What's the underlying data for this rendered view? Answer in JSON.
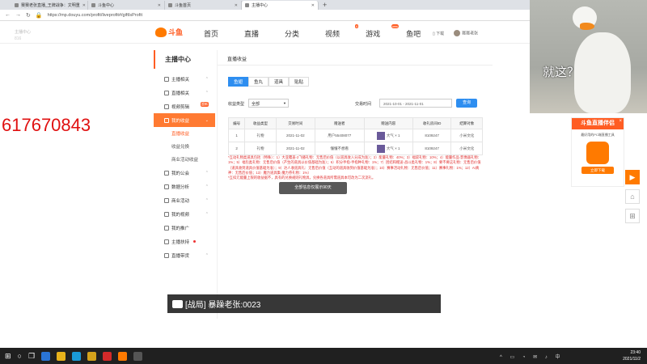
{
  "browser": {
    "tabs": [
      {
        "label": "赛赛老张直播_王牌战争：文明重",
        "active": false
      },
      {
        "label": "斗鱼中心",
        "active": false
      },
      {
        "label": "斗鱼首页",
        "active": false
      },
      {
        "label": "主播中心",
        "active": true
      }
    ],
    "url": "https://mp.douyu.com/profit/liveprofit#/giftIsProfit"
  },
  "ghost": {
    "line1": "主播中心",
    "line2": "816"
  },
  "overlay_number": "617670843",
  "header": {
    "logo": "斗鱼",
    "nav": [
      {
        "label": "首页",
        "badge": ""
      },
      {
        "label": "直播",
        "badge": ""
      },
      {
        "label": "分类",
        "badge": ""
      },
      {
        "label": "视频",
        "badge": "6"
      },
      {
        "label": "游戏",
        "badge": "new"
      },
      {
        "label": "鱼吧",
        "badge": ""
      }
    ],
    "download": "下载",
    "username": "赛赛老张"
  },
  "sidebar": {
    "title": "主播中心",
    "items": [
      {
        "label": "主播相关"
      },
      {
        "label": "直播相关"
      },
      {
        "label": "视频剪辑",
        "hot": "超新"
      },
      {
        "label": "我的收益",
        "active": true
      },
      {
        "label": "我的公会"
      },
      {
        "label": "数据分析"
      },
      {
        "label": "商业活动"
      },
      {
        "label": "我的视频"
      },
      {
        "label": "我的推广"
      },
      {
        "label": "主播扶持"
      },
      {
        "label": "直播带货"
      }
    ],
    "subitems": [
      "直播收益",
      "收益兑换",
      "商业活动收益"
    ]
  },
  "main": {
    "title": "直播收益",
    "subtabs": [
      "鱼翅",
      "鱼丸",
      "道具",
      "贴贴"
    ],
    "filter": {
      "type_label": "收益类型",
      "type_value": "全部",
      "time_label": "交易时间",
      "date_range": "2021-10-01 - 2021-11-01",
      "query_button": "查询"
    },
    "table": {
      "headers": [
        "编号",
        "收益类型",
        "交易时间",
        "赠送者",
        "赠送内容",
        "收礼房间ID",
        "结算对象"
      ],
      "rows": [
        [
          "1",
          "礼物",
          "2021-11-02",
          "用户55408077",
          "大气 × 1",
          "8109247",
          "小米文化"
        ],
        [
          "2",
          "礼物",
          "2021-11-02",
          "懂懂不想看",
          "大气 × 1",
          "8109247",
          "小米文化"
        ]
      ]
    },
    "notes": [
      "*互动礼物类道具包括（特殊）：1）大亚覆盖-2飞播礼物：无售后价值（以道具收入分成为准）；2）能量礼物：40%；3）福袋礼物：10%；4）能量作品·影像器礼物：1%；5）福包类礼物：无售后价值（产生的道具以价值基础为准）；6）积分手指-手指种礼物：1%；7）团结和赠送-战斗类礼物：1%；8）要不要这礼物：无售后价值（道具收到道具价值基础为准）；9）达人收道具礼：无售后价值（互动的道具收到价值基础为准）；10）赛事活动礼物：无售后价值；11）赛事礼物：1%；12）AI真神：无售后价值；13）魔力道具集·魔力券礼物：1%）",
      "*互扣元能量上限的收益据不，具有的兑换规则礼物具，兑换各道具所需道具本可改为二次流礼。"
    ],
    "toast": "全部信息仅展示90天"
  },
  "chat": {
    "text": "[战局] 暴躁老张:0023"
  },
  "webcam": {
    "caption": "就这？"
  },
  "ad": {
    "title": "斗鱼直播伴侣",
    "subtitle": "最好用的PC端直播工具",
    "app_name": "douyu",
    "button": "立即下载"
  },
  "taskbar": {
    "time": "23:40",
    "date": "2021/11/2",
    "lang": "中"
  },
  "colors": {
    "brand": "#ff5d23",
    "accent": "#2e8ef0",
    "overlay_number": "#e01010"
  }
}
